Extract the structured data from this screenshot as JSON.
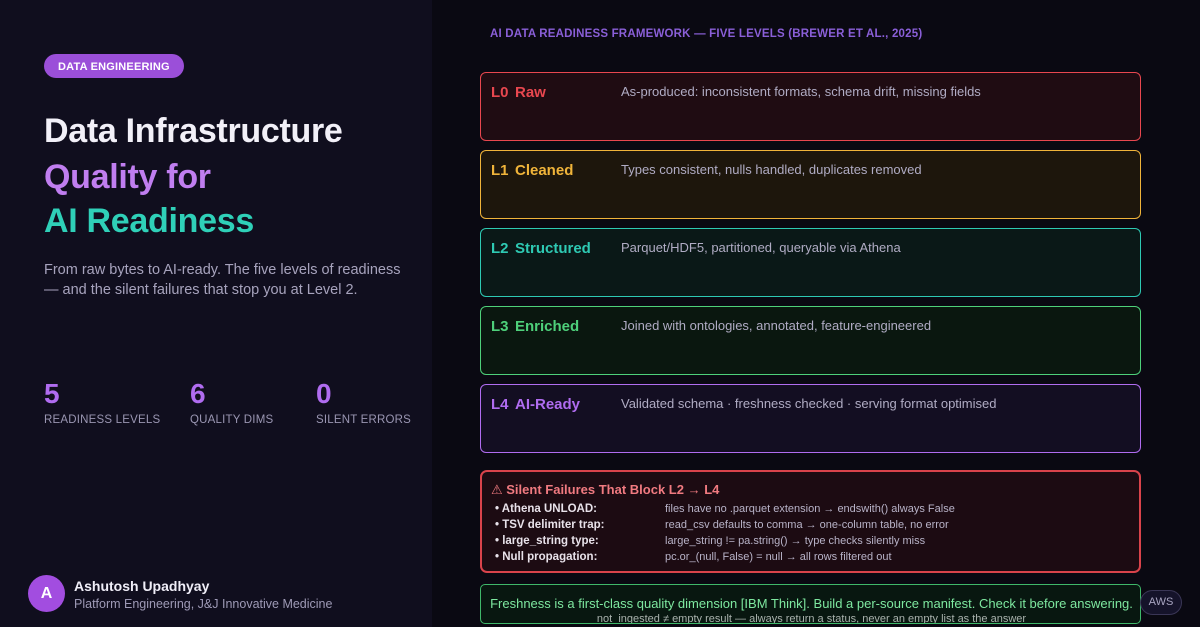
{
  "hero": {
    "badge": "DATA ENGINEERING",
    "title_line1": "Data Infrastructure",
    "title_line2": "Quality for",
    "title_line3": "AI Readiness",
    "description": "From raw bytes to AI-ready. The five levels of readiness — and the silent failures that stop you at Level 2."
  },
  "stats": [
    {
      "value": "5",
      "label": "READINESS LEVELS"
    },
    {
      "value": "6",
      "label": "QUALITY DIMS"
    },
    {
      "value": "0",
      "label": "SILENT ERRORS"
    }
  ],
  "author": {
    "initial": "A",
    "name": "Ashutosh Upadhyay",
    "role": "Platform Engineering, J&J Innovative Medicine"
  },
  "framework": {
    "title": "AI DATA READINESS FRAMEWORK — FIVE LEVELS (BREWER ET AL., 2025)",
    "levels": [
      {
        "code": "L0",
        "name": "Raw",
        "text": "As-produced: inconsistent formats, schema drift, missing fields",
        "color": "#e8474f",
        "bg": "#1f0c12"
      },
      {
        "code": "L1",
        "name": "Cleaned",
        "text": "Types consistent, nulls handled, duplicates removed",
        "color": "#f0b43a",
        "bg": "#1d160c"
      },
      {
        "code": "L2",
        "name": "Structured",
        "text": "Parquet/HDF5, partitioned, queryable via Athena",
        "color": "#2ec9b3",
        "bg": "#0a1817"
      },
      {
        "code": "L3",
        "name": "Enriched",
        "text": "Joined with ontologies, annotated, feature-engineered",
        "color": "#4ed07a",
        "bg": "#0a170f"
      },
      {
        "code": "L4",
        "name": "AI-Ready",
        "text": "Validated schema · freshness checked · serving format optimised",
        "color": "#b06cf0",
        "bg": "#130e22"
      }
    ]
  },
  "failures": {
    "heading": "⚠ Silent Failures That Block L2 → L4",
    "items": [
      {
        "key": "• Athena UNLOAD:",
        "value": "files have no .parquet extension → endswith() always False"
      },
      {
        "key": "• TSV delimiter trap:",
        "value": "read_csv defaults to comma → one-column table, no error"
      },
      {
        "key": "• large_string type:",
        "value": "large_string != pa.string() → type checks silently miss"
      },
      {
        "key": "• Null propagation:",
        "value": "pc.or_(null, False) = null → all rows filtered out"
      }
    ]
  },
  "freshness": {
    "line1": "Freshness is a first-class quality dimension [IBM Think]. Build a per-source manifest. Check it before answering.",
    "line2": "not_ingested ≠ empty result — always return a status, never an empty list as the answer"
  },
  "tag": "AWS"
}
